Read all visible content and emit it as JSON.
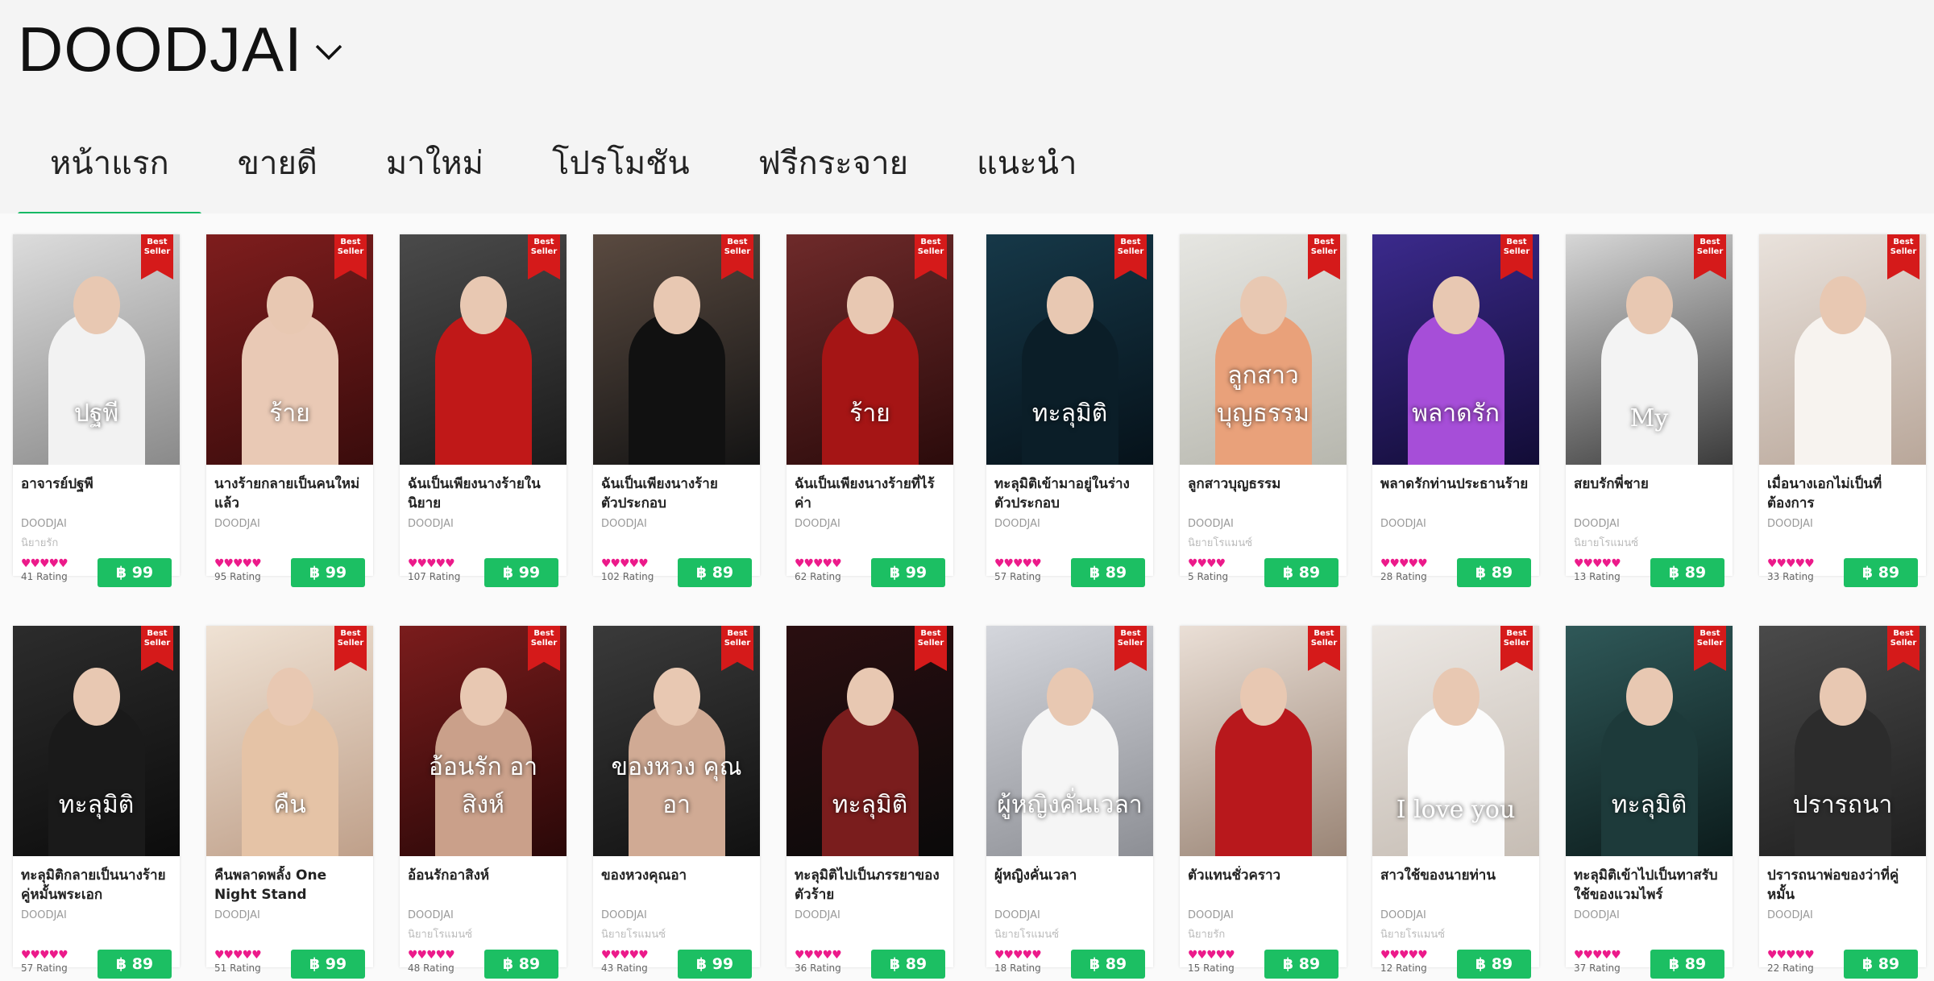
{
  "store": {
    "name": "DOODJAI"
  },
  "tabs": [
    "หน้าแรก",
    "ขายดี",
    "มาใหม่",
    "โปรโมชัน",
    "ฟรีกระจาย",
    "แนะนำ"
  ],
  "active_tab": 0,
  "badge": "Best Seller",
  "books": [
    {
      "title": "อาจารย์ปฐพี",
      "author": "DOODJAI",
      "sub": "นิยายรัก",
      "stars": 5,
      "rating": "41 Rating",
      "price": "฿ 99",
      "cover_text": "ปฐพี",
      "c1": "#dcdcdc",
      "c2": "#8a8a8a",
      "fig": "#f2f2f2"
    },
    {
      "title": "นางร้ายกลายเป็นคนใหม่แล้ว",
      "author": "DOODJAI",
      "sub": "",
      "stars": 5,
      "rating": "95 Rating",
      "price": "฿ 99",
      "cover_text": "ร้าย",
      "c1": "#7e1d1d",
      "c2": "#3a0c0c",
      "fig": "#e9c9b5"
    },
    {
      "title": "ฉันเป็นเพียงนางร้ายในนิยาย",
      "author": "DOODJAI",
      "sub": "",
      "stars": 5,
      "rating": "107 Rating",
      "price": "฿ 99",
      "cover_text": "",
      "c1": "#4a4a4a",
      "c2": "#1b1b1b",
      "fig": "#c01818"
    },
    {
      "title": "ฉันเป็นเพียงนางร้ายตัวประกอบ",
      "author": "DOODJAI",
      "sub": "",
      "stars": 5,
      "rating": "102 Rating",
      "price": "฿ 89",
      "cover_text": "",
      "c1": "#5a4a40",
      "c2": "#141414",
      "fig": "#111111"
    },
    {
      "title": "ฉันเป็นเพียงนางร้ายที่ไร้ค่า",
      "author": "DOODJAI",
      "sub": "",
      "stars": 5,
      "rating": "62 Rating",
      "price": "฿ 99",
      "cover_text": "ร้าย",
      "c1": "#6e2a2a",
      "c2": "#2b0b0b",
      "fig": "#a51515"
    },
    {
      "title": "ทะลุมิติเข้ามาอยู่ในร่างตัวประกอบ",
      "author": "DOODJAI",
      "sub": "",
      "stars": 5,
      "rating": "57 Rating",
      "price": "฿ 89",
      "cover_text": "ทะลุมิติ",
      "c1": "#163848",
      "c2": "#06121a",
      "fig": "#0b1e28"
    },
    {
      "title": "ลูกสาวบุญธรรม",
      "author": "DOODJAI",
      "sub": "นิยายโรแมนซ์",
      "stars": 4,
      "rating": "5 Rating",
      "price": "฿ 89",
      "cover_text": "ลูกสาวบุญธรรม",
      "c1": "#e6e6e2",
      "c2": "#b7b7ae",
      "fig": "#e9a17a"
    },
    {
      "title": "พลาดรักท่านประธานร้าย",
      "author": "DOODJAI",
      "sub": "",
      "stars": 5,
      "rating": "28 Rating",
      "price": "฿ 89",
      "cover_text": "พลาดรัก",
      "c1": "#3b2a8c",
      "c2": "#120c36",
      "fig": "#a64ed8"
    },
    {
      "title": "สยบรักพี่ชาย",
      "author": "DOODJAI",
      "sub": "นิยายโรแมนซ์",
      "stars": 5,
      "rating": "13 Rating",
      "price": "฿ 89",
      "cover_text": "My",
      "c1": "#d7d7d7",
      "c2": "#3b3b3b",
      "fig": "#f3f3f3"
    },
    {
      "title": "เมื่อนางเอกไม่เป็นที่ต้องการ",
      "author": "DOODJAI",
      "sub": "",
      "stars": 5,
      "rating": "33 Rating",
      "price": "฿ 89",
      "cover_text": "",
      "c1": "#e9e2dc",
      "c2": "#b9a79a",
      "fig": "#f7f3ef"
    },
    {
      "title": "ทะลุมิติกลายเป็นนางร้ายคู่หมั้นพระเอก",
      "author": "DOODJAI",
      "sub": "",
      "stars": 5,
      "rating": "57 Rating",
      "price": "฿ 89",
      "cover_text": "ทะลุมิติ",
      "c1": "#2c2c2c",
      "c2": "#0c0c0c",
      "fig": "#1a1a1a"
    },
    {
      "title": "คืนพลาดพลั้ง One Night Stand",
      "author": "DOODJAI",
      "sub": "",
      "stars": 5,
      "rating": "51 Rating",
      "price": "฿ 99",
      "cover_text": "คืน",
      "c1": "#efe2d4",
      "c2": "#bfa08a",
      "fig": "#e5c3a6"
    },
    {
      "title": "อ้อนรักอาสิงห์",
      "author": "DOODJAI",
      "sub": "นิยายโรแมนซ์",
      "stars": 5,
      "rating": "48 Rating",
      "price": "฿ 89",
      "cover_text": "อ้อนรัก อาสิงห์",
      "c1": "#7a1c1c",
      "c2": "#2a0808",
      "fig": "#caa08a"
    },
    {
      "title": "ของหวงคุณอา",
      "author": "DOODJAI",
      "sub": "นิยายโรแมนซ์",
      "stars": 5,
      "rating": "43 Rating",
      "price": "฿ 99",
      "cover_text": "ของหวง คุณอา",
      "c1": "#3a3a3a",
      "c2": "#111111",
      "fig": "#d0aa94"
    },
    {
      "title": "ทะลุมิติไปเป็นภรรยาของตัวร้าย",
      "author": "DOODJAI",
      "sub": "",
      "stars": 5,
      "rating": "36 Rating",
      "price": "฿ 89",
      "cover_text": "ทะลุมิติ",
      "c1": "#2a0e10",
      "c2": "#0a0a0a",
      "fig": "#7a1d1d"
    },
    {
      "title": "ผู้หญิงคั่นเวลา",
      "author": "DOODJAI",
      "sub": "นิยายโรแมนซ์",
      "stars": 5,
      "rating": "18 Rating",
      "price": "฿ 89",
      "cover_text": "ผู้หญิงคั่นเวลา",
      "c1": "#d4d6dc",
      "c2": "#8d8f95",
      "fig": "#f5f5f5"
    },
    {
      "title": "ตัวแทนชั่วคราว",
      "author": "DOODJAI",
      "sub": "นิยายรัก",
      "stars": 5,
      "rating": "15 Rating",
      "price": "฿ 89",
      "cover_text": "",
      "c1": "#eadfd6",
      "c2": "#9a8576",
      "fig": "#b8181c"
    },
    {
      "title": "สาวใช้ของนายท่าน",
      "author": "DOODJAI",
      "sub": "นิยายโรแมนซ์",
      "stars": 5,
      "rating": "12 Rating",
      "price": "฿ 89",
      "cover_text": "I love you",
      "c1": "#ece8e4",
      "c2": "#c6bdb4",
      "fig": "#fbfbfb"
    },
    {
      "title": "ทะลุมิติเข้าไปเป็นทาสรับใช้ของแวมไพร์",
      "author": "DOODJAI",
      "sub": "",
      "stars": 5,
      "rating": "37 Rating",
      "price": "฿ 89",
      "cover_text": "ทะลุมิติ",
      "c1": "#2f5858",
      "c2": "#0c1c1c",
      "fig": "#1d3a3a"
    },
    {
      "title": "ปรารถนาพ่อของว่าที่คู่หมั้น",
      "author": "DOODJAI",
      "sub": "",
      "stars": 5,
      "rating": "22 Rating",
      "price": "฿ 89",
      "cover_text": "ปรารถนา",
      "c1": "#4a4a4a",
      "c2": "#1f1f1f",
      "fig": "#2c2c2c"
    }
  ]
}
